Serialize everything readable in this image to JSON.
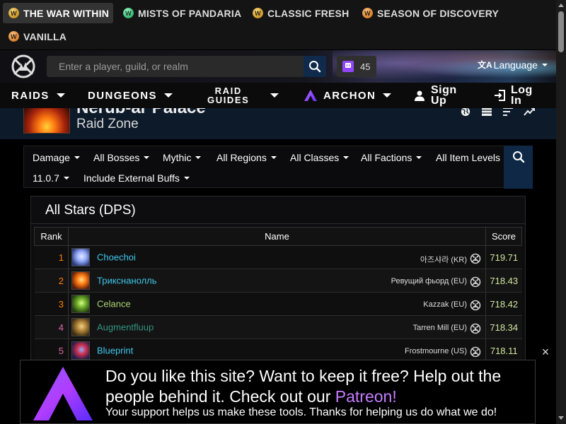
{
  "game_tabs": [
    {
      "label": "THE WAR WITHIN",
      "icon": "wow-war-within-icon"
    },
    {
      "label": "MISTS OF PANDARIA",
      "icon": "wow-mists-icon"
    },
    {
      "label": "CLASSIC FRESH",
      "icon": "wow-classic-fresh-icon"
    },
    {
      "label": "SEASON OF DISCOVERY",
      "icon": "wow-sod-icon"
    },
    {
      "label": "VANILLA",
      "icon": "wow-vanilla-icon"
    }
  ],
  "header": {
    "search_placeholder": "Enter a player, guild, or realm",
    "twitch_count": "45",
    "language_label": "Language"
  },
  "nav": {
    "raids": "RAIDS",
    "dungeons": "DUNGEONS",
    "raid_guides_line1": "RAID",
    "raid_guides_line2": "GUIDES",
    "archon": "ARCHON",
    "sign_up_line1": "Sign",
    "sign_up_line2": "Up",
    "log_in_line1": "Log",
    "log_in_line2": "In"
  },
  "zone": {
    "title": "Nerub-ar Palace",
    "subtitle": "Raid Zone"
  },
  "filters": {
    "metric": "Damage",
    "bosses": "All Bosses",
    "difficulty": "Mythic",
    "regions": "All Regions",
    "classes": "All Classes",
    "factions": "All Factions",
    "item_levels": "All Item Levels",
    "patch": "11.0.7",
    "buffs": "Include External Buffs"
  },
  "panel": {
    "title": "All Stars (DPS)",
    "columns": {
      "rank": "Rank",
      "name": "Name",
      "score": "Score"
    },
    "rows": [
      {
        "rank": "1",
        "name": "Choechoi",
        "server": "아즈샤라 (KR)",
        "score": "719.71",
        "rank_color": "#ff8000",
        "name_color": "#3fc7eb",
        "spec_colors": [
          "#2a3a7a",
          "#9ab0ff",
          "#e8e8ff"
        ]
      },
      {
        "rank": "2",
        "name": "Трикснанолль",
        "server": "Ревущий фьорд (EU)",
        "score": "718.43",
        "rank_color": "#ff8000",
        "name_color": "#3fc7eb",
        "spec_colors": [
          "#5a1a08",
          "#ff7a12",
          "#ffe08a"
        ]
      },
      {
        "rank": "3",
        "name": "Celance",
        "server": "Kazzak (EU)",
        "score": "718.42",
        "rank_color": "#ff8000",
        "name_color": "#aad372",
        "spec_colors": [
          "#1f3a10",
          "#6fae2a",
          "#d8ff8a"
        ]
      },
      {
        "rank": "4",
        "name": "Augmentfluup",
        "server": "Tarren Mill (EU)",
        "score": "718.34",
        "rank_color": "#e268a8",
        "name_color": "#33937f",
        "spec_colors": [
          "#3a2a10",
          "#b0863a",
          "#f0d08a"
        ]
      },
      {
        "rank": "5",
        "name": "Blueprint",
        "server": "Frostmourne (US)",
        "score": "718.11",
        "rank_color": "#e268a8",
        "name_color": "#3fc7eb",
        "spec_colors": [
          "#1a1a4a",
          "#d03050",
          "#8ab0ff"
        ]
      }
    ]
  },
  "ad": {
    "headline_part1": "Do you like this site? Want to keep it free? Help out the people behind it. Check out our ",
    "headline_link": "Patreon!",
    "subtext": "Your support helps us make these tools. Thanks for helping us do what we do!",
    "close": "×"
  },
  "colors": {
    "accent_purple": "#9147ff",
    "patreon_purple": "#c77dff",
    "score_green": "#cfe8a0"
  }
}
